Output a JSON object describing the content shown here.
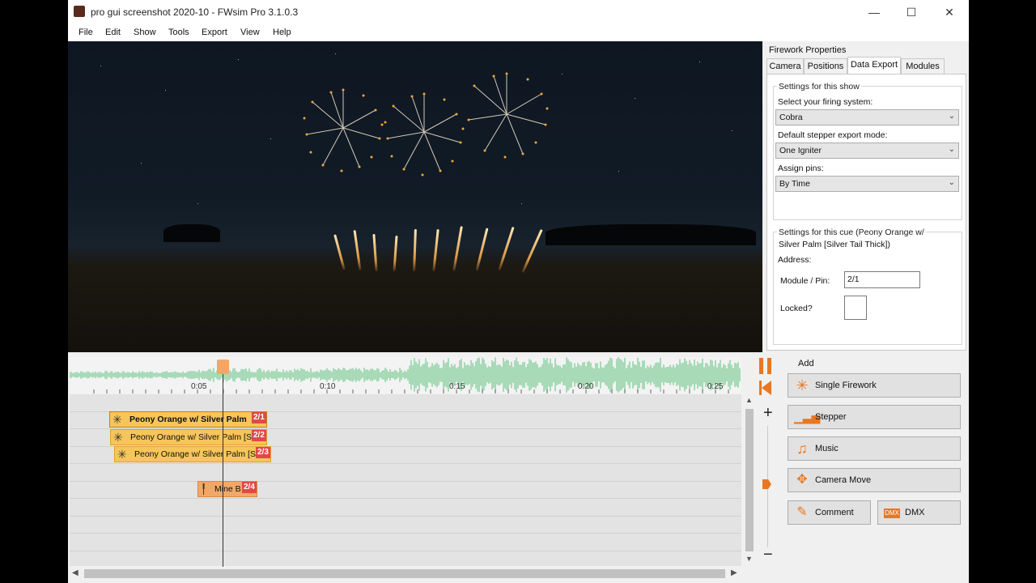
{
  "window": {
    "title": "pro gui screenshot 2020-10 - FWsim Pro 3.1.0.3",
    "minimize_glyph": "—",
    "maximize_glyph": "☐",
    "close_glyph": "✕"
  },
  "menu": [
    "File",
    "Edit",
    "Show",
    "Tools",
    "Export",
    "View",
    "Help"
  ],
  "properties": {
    "title": "Firework Properties",
    "tabs": [
      "Camera",
      "Positions",
      "Data Export",
      "Modules"
    ],
    "active_tab": "Data Export",
    "show_group": {
      "legend": "Settings for this show",
      "firing_label": "Select your firing system:",
      "firing_value": "Cobra",
      "stepper_label": "Default stepper export mode:",
      "stepper_value": "One Igniter",
      "pins_label": "Assign pins:",
      "pins_value": "By Time"
    },
    "cue_group": {
      "legend_line1": "Settings for this cue (Peony Orange w/",
      "legend_line2": "Silver Palm [Silver Tail Thick])",
      "address_label": "Address:",
      "module_pin_label": "Module / Pin:",
      "module_pin_value": "2/1",
      "locked_label": "Locked?"
    }
  },
  "timeline": {
    "ticks": [
      "0:05",
      "0:10",
      "0:15",
      "0:20",
      "0:25"
    ],
    "cues": [
      {
        "label": "Peony Orange w/ Silver Palm",
        "pin": "2/1",
        "selected": true
      },
      {
        "label": "Peony Orange w/ Silver Palm [S",
        "pin": "2/2"
      },
      {
        "label": "Peony Orange w/ Silver Palm [S",
        "pin": "2/3"
      },
      {
        "label": "Mine B",
        "pin": "2/4"
      }
    ]
  },
  "controls": {
    "add_label": "Add",
    "buttons": [
      "Single Firework",
      "Stepper",
      "Music",
      "Camera Move",
      "Comment",
      "DMX"
    ],
    "zoom_in": "+",
    "zoom_out": "−"
  },
  "colors": {
    "accent": "#e87722",
    "cue_fill": "#f6c55b",
    "pin_badge": "#e24848",
    "waveform": "#8fd1a5"
  }
}
